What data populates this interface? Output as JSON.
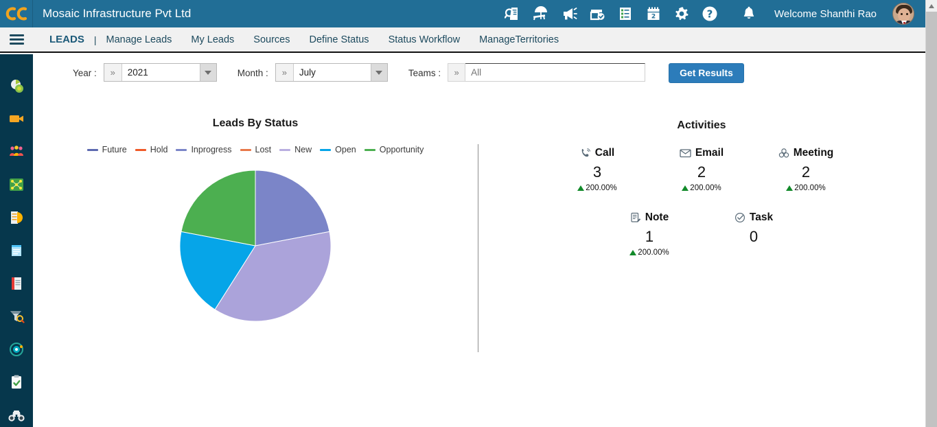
{
  "header": {
    "logo_text": "CC",
    "app_title": "Mosaic Infrastructure Pvt Ltd",
    "welcome_text": "Welcome Shanthi Rao",
    "brand_color": "#216e96",
    "icons": [
      {
        "name": "search-document-icon",
        "title": "Search"
      },
      {
        "name": "site-visit-icon",
        "title": "Site Visit"
      },
      {
        "name": "megaphone-icon",
        "title": "Announcements"
      },
      {
        "name": "calendar-check-icon",
        "title": "Tasks"
      },
      {
        "name": "checklist-icon",
        "title": "Checklist"
      },
      {
        "name": "calendar-icon",
        "title": "Calendar"
      },
      {
        "name": "gear-icon",
        "title": "Settings"
      },
      {
        "name": "help-icon",
        "title": "Help"
      }
    ],
    "bell_icon": "notification-bell-icon",
    "avatar": "user-avatar"
  },
  "menu": {
    "hamburger": "menu-toggle",
    "active_item": "LEADS",
    "separator": "|",
    "items": [
      {
        "label": "LEADS",
        "active": true
      },
      {
        "label": "Manage Leads",
        "active": false
      },
      {
        "label": "My Leads",
        "active": false
      },
      {
        "label": "Sources",
        "active": false
      },
      {
        "label": "Define Status",
        "active": false
      },
      {
        "label": "Status Workflow",
        "active": false
      },
      {
        "label": "ManageTerritories",
        "active": false
      }
    ]
  },
  "sidebar": {
    "background": "#06374c",
    "items": [
      {
        "name": "dashboard-icon",
        "label": "Dashboard"
      },
      {
        "name": "video-camera-icon",
        "label": "Media"
      },
      {
        "name": "team-people-icon",
        "label": "Teams"
      },
      {
        "name": "network-map-icon",
        "label": "Network"
      },
      {
        "name": "reports-icon",
        "label": "Reports"
      },
      {
        "name": "notepad-icon",
        "label": "Notes"
      },
      {
        "name": "documents-icon",
        "label": "Documents"
      },
      {
        "name": "funnel-search-icon",
        "label": "Filters"
      },
      {
        "name": "target-icon",
        "label": "Targets"
      },
      {
        "name": "clipboard-check-icon",
        "label": "Approvals"
      },
      {
        "name": "binoculars-icon",
        "label": "Explore"
      }
    ]
  },
  "filters": {
    "year": {
      "label": "Year :",
      "value": "2021",
      "placeholder": ""
    },
    "month": {
      "label": "Month :",
      "value": "July",
      "placeholder": ""
    },
    "teams": {
      "label": "Teams :",
      "value": "",
      "placeholder": "All"
    },
    "chevron": "»",
    "get_results_label": "Get Results",
    "button_color": "#2c7cba"
  },
  "chart_data": {
    "type": "pie",
    "title": "Leads By Status",
    "legend_position": "top",
    "legend": [
      "Future",
      "Hold",
      "Inprogress",
      "Lost",
      "New",
      "Open",
      "Opportunity"
    ],
    "legend_colors": [
      "#5d6ab0",
      "#f05a28",
      "#7b85c8",
      "#e8784a",
      "#b9aee0",
      "#06a5e8",
      "#4caf50"
    ],
    "categories": [
      "Inprogress",
      "New",
      "Open",
      "Opportunity"
    ],
    "values": [
      2.2,
      3.7,
      1.9,
      2.2
    ],
    "percentages": [
      22.2,
      36.7,
      19.4,
      21.7
    ],
    "colors": [
      "#7b85c8",
      "#aba3da",
      "#06a5e8",
      "#4caf50"
    ],
    "xlabel": "",
    "ylabel": ""
  },
  "activities": {
    "title": "Activities",
    "rows": [
      [
        {
          "icon": "phone-call-icon",
          "label": "Call",
          "value": "3",
          "change": "200.00%",
          "direction": "up"
        },
        {
          "icon": "envelope-icon",
          "label": "Email",
          "value": "2",
          "change": "200.00%",
          "direction": "up"
        },
        {
          "icon": "meeting-icon",
          "label": "Meeting",
          "value": "2",
          "change": "200.00%",
          "direction": "up"
        }
      ],
      [
        {
          "icon": "note-edit-icon",
          "label": "Note",
          "value": "1",
          "change": "200.00%",
          "direction": "up"
        },
        {
          "icon": "task-check-icon",
          "label": "Task",
          "value": "0",
          "change": "",
          "direction": "none"
        }
      ]
    ],
    "change_up_color": "#128a2a"
  },
  "scrollbar": {
    "name": "page-scrollbar",
    "position": "right"
  }
}
